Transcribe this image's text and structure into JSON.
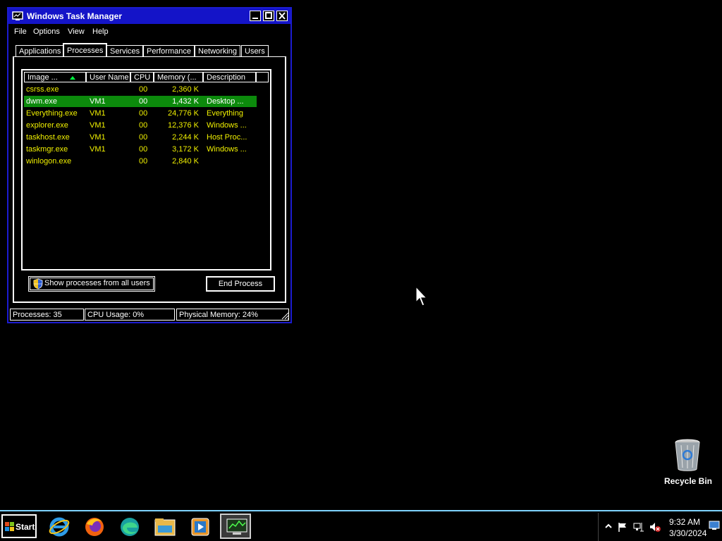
{
  "window": {
    "title": "Windows Task Manager",
    "menu": [
      "File",
      "Options",
      "View",
      "Help"
    ],
    "tabs": [
      "Applications",
      "Processes",
      "Services",
      "Performance",
      "Networking",
      "Users"
    ],
    "active_tab": "Processes"
  },
  "processes": {
    "columns": [
      "Image ...",
      "User Name",
      "CPU",
      "Memory (...",
      "Description"
    ],
    "sorted_column": "Image ...",
    "rows": [
      {
        "name": "csrss.exe",
        "user": "",
        "cpu": "00",
        "memory": "2,360 K",
        "description": ""
      },
      {
        "name": "dwm.exe",
        "user": "VM1",
        "cpu": "00",
        "memory": "1,432 K",
        "description": "Desktop ...",
        "selected": true
      },
      {
        "name": "Everything.exe",
        "user": "VM1",
        "cpu": "00",
        "memory": "24,776 K",
        "description": "Everything"
      },
      {
        "name": "explorer.exe",
        "user": "VM1",
        "cpu": "00",
        "memory": "12,376 K",
        "description": "Windows ..."
      },
      {
        "name": "taskhost.exe",
        "user": "VM1",
        "cpu": "00",
        "memory": "2,244 K",
        "description": "Host Proc..."
      },
      {
        "name": "taskmgr.exe",
        "user": "VM1",
        "cpu": "00",
        "memory": "3,172 K",
        "description": "Windows ..."
      },
      {
        "name": "winlogon.exe",
        "user": "",
        "cpu": "00",
        "memory": "2,840 K",
        "description": ""
      }
    ]
  },
  "buttons": {
    "show_all": "Show processes from all users",
    "end_process": "End Process"
  },
  "status": {
    "processes": "Processes: 35",
    "cpu": "CPU Usage: 0%",
    "memory": "Physical Memory: 24%"
  },
  "desktop": {
    "recycle_bin": "Recycle Bin"
  },
  "taskbar": {
    "start": "Start",
    "apps": [
      "internet-explorer-icon",
      "firefox-icon",
      "edge-icon",
      "file-explorer-icon",
      "media-player-icon",
      "task-manager-icon"
    ],
    "time": "9:32 AM",
    "date": "3/30/2024"
  },
  "colors": {
    "titlebar": "#1414c8",
    "row_text": "#f0f000",
    "selected_row": "#0c8a0c",
    "taskbar_border": "#7fd4ff"
  }
}
